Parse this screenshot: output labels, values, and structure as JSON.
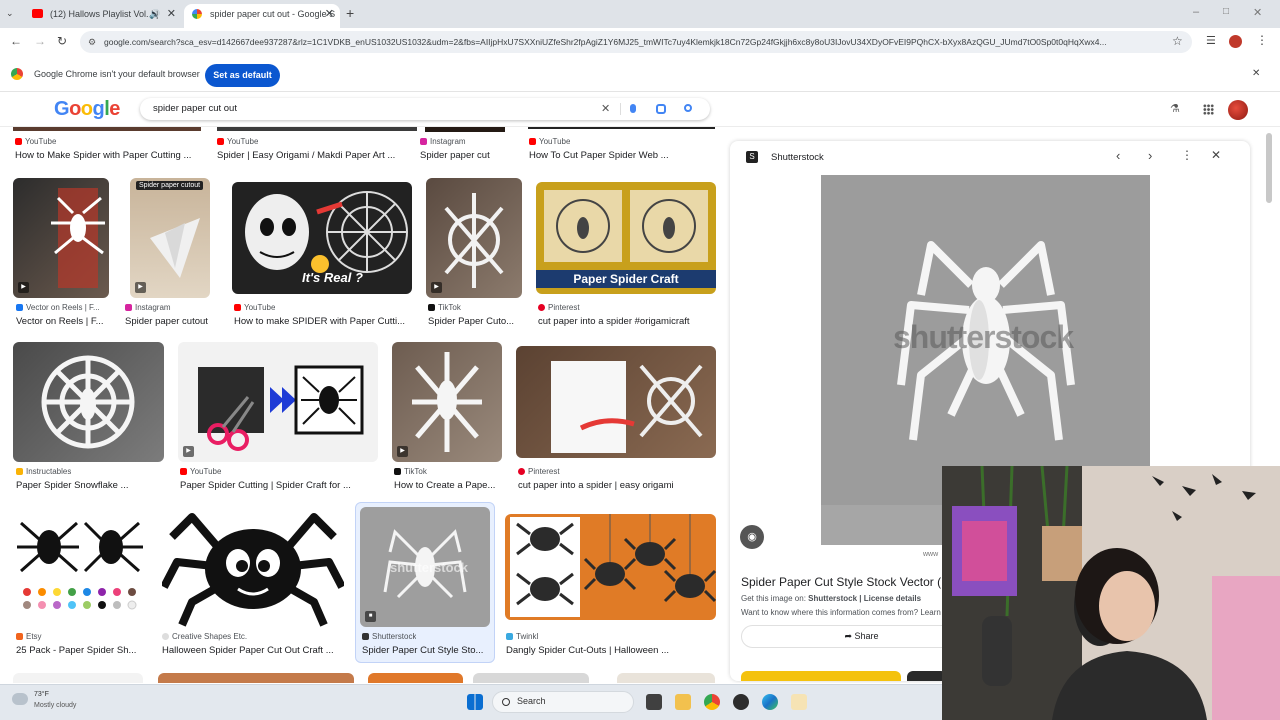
{
  "browser": {
    "tabs": [
      {
        "title": "(12) Hallows Playlist Vol. I |",
        "active": false
      },
      {
        "title": "spider paper cut out - Google S",
        "active": true
      }
    ],
    "url": "google.com/search?sca_esv=d142667dee937287&rlz=1C1VDKB_enUS1032US1032&udm=2&fbs=AIIjpHxU7SXXniUZfeShr2fpAgiZ1Y6MJ25_tmWITc7uy4Klemkjk18Cn72Gp24fGkjjh6xc8y8oU3IJovU34XDyOFvEI9PQhCX-bXyx8AzQGU_JUmd7tO0Sp0t0qHqXwx4...",
    "infobar_text": "Google Chrome isn't your default browser",
    "infobar_button": "Set as default"
  },
  "google": {
    "logo": "Google",
    "query": "spider paper cut out"
  },
  "results": [
    {
      "source": "YouTube",
      "title": "How to Make Spider with Paper Cutting ..."
    },
    {
      "source": "YouTube",
      "title": "Spider | Easy Origami / Makdi Paper Art ..."
    },
    {
      "source": "Instagram",
      "title": "Spider paper cut"
    },
    {
      "source": "YouTube",
      "title": "How To Cut Paper Spider Web ..."
    },
    {
      "source": "Vector on Reels | F...",
      "title": "Vector on Reels | F..."
    },
    {
      "source": "Instagram",
      "title": "Spider paper cutout",
      "overlay": "Spider paper cutout"
    },
    {
      "source": "YouTube",
      "title": "How to make SPIDER with Paper Cutti...",
      "overlay": "It's Real ?"
    },
    {
      "source": "TikTok",
      "title": "Spider Paper Cuto..."
    },
    {
      "source": "Pinterest",
      "title": "cut paper into a spider #origamicraft",
      "overlay": "Paper Spider Craft"
    },
    {
      "source": "Instructables",
      "title": "Paper Spider Snowflake ..."
    },
    {
      "source": "YouTube",
      "title": "Paper Spider Cutting | Spider Craft for ..."
    },
    {
      "source": "TikTok",
      "title": "How to Create a Pape..."
    },
    {
      "source": "Pinterest",
      "title": "cut paper into a spider | easy origami"
    },
    {
      "source": "Etsy",
      "title": "25 Pack - Paper Spider Sh..."
    },
    {
      "source": "Creative Shapes Etc.",
      "title": "Halloween Spider Paper Cut Out Craft ..."
    },
    {
      "source": "Shutterstock",
      "title": "Spider Paper Cut Style Sto..."
    },
    {
      "source": "Twinkl",
      "title": "Dangly Spider Cut-Outs | Halloween ..."
    }
  ],
  "panel": {
    "source": "Shutterstock",
    "watermark": "shutterstock",
    "title": "Spider Paper Cut Style Stock Vector (R",
    "get_image_label": "Get this image on:",
    "get_image_value": "Shutterstock | License details",
    "info_text": "Want to know where this information comes from?",
    "info_link": "Learn",
    "share_label": "Share",
    "small_text": "www"
  },
  "taskbar": {
    "weather_temp": "73°F",
    "weather_desc": "Mostly cloudy",
    "search_label": "Search"
  },
  "colors": {
    "google_blue": "#4285f4",
    "google_red": "#ea4335",
    "google_yellow": "#fbbc05",
    "google_green": "#34a853",
    "button_blue": "#0b57d0",
    "youtube_red": "#ff0000",
    "pinterest_red": "#e60023",
    "instagram": "#d6249f"
  }
}
